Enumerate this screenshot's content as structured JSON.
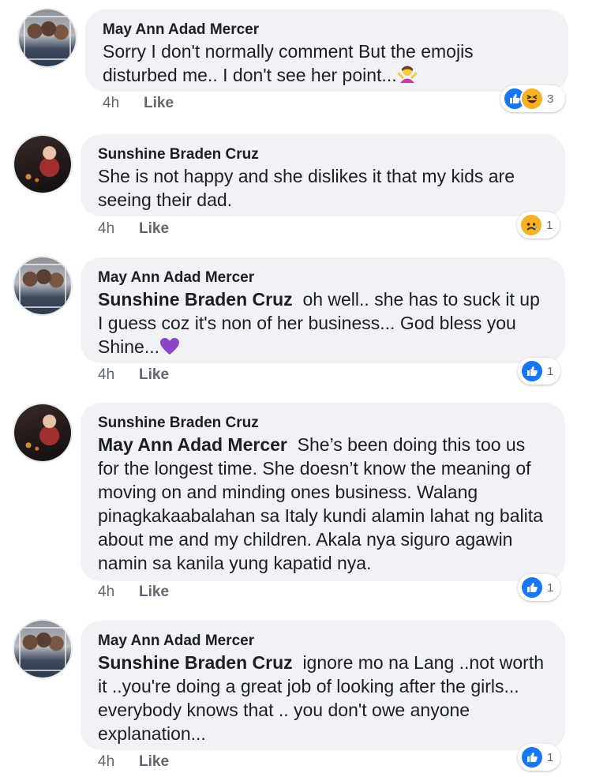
{
  "comments": [
    {
      "author": "May Ann Adad Mercer",
      "mention": "",
      "text": "Sorry I don't normally comment But the emojis disturbed me.. I don't see her point...",
      "inline_emoji": "person-gesturing-shrug",
      "time": "4h",
      "like_label": "Like",
      "reactions": [
        "like",
        "haha"
      ],
      "reaction_count": "3"
    },
    {
      "author": "Sunshine Braden Cruz",
      "mention": "",
      "text": "She is not happy and she dislikes it that my kids are seeing their dad.",
      "time": "4h",
      "like_label": "Like",
      "reactions": [
        "sad"
      ],
      "reaction_count": "1"
    },
    {
      "author": "May Ann Adad Mercer",
      "mention": "Sunshine Braden Cruz",
      "text": "oh well.. she has to suck it up I guess coz it's non of her business... God bless you Shine...",
      "inline_emoji": "purple-heart",
      "time": "4h",
      "like_label": "Like",
      "reactions": [
        "like"
      ],
      "reaction_count": "1"
    },
    {
      "author": "Sunshine Braden Cruz",
      "mention": "May Ann Adad Mercer",
      "text": "She’s been doing this too us for the longest time. She doesn’t know the meaning of moving on and minding ones business. Walang pinagkakaabalahan sa Italy kundi alamin lahat ng balita about me and my children. Akala nya siguro agawin namin sa kanila yung kapatid nya.",
      "time": "4h",
      "like_label": "Like",
      "reactions": [
        "like"
      ],
      "reaction_count": "1"
    },
    {
      "author": "May Ann Adad Mercer",
      "mention": "Sunshine Braden Cruz",
      "text": "ignore mo na Lang ..not worth it ..you're doing a great job of looking after the girls... everybody knows that .. you don't owe anyone explanation...",
      "time": "4h",
      "like_label": "Like",
      "reactions": [
        "like"
      ],
      "reaction_count": "1"
    }
  ],
  "colors": {
    "bubble": "#f0f2f5",
    "like_blue": "#1877f2",
    "emoji_yellow": "#f7b125",
    "meta_grey": "#606770"
  }
}
